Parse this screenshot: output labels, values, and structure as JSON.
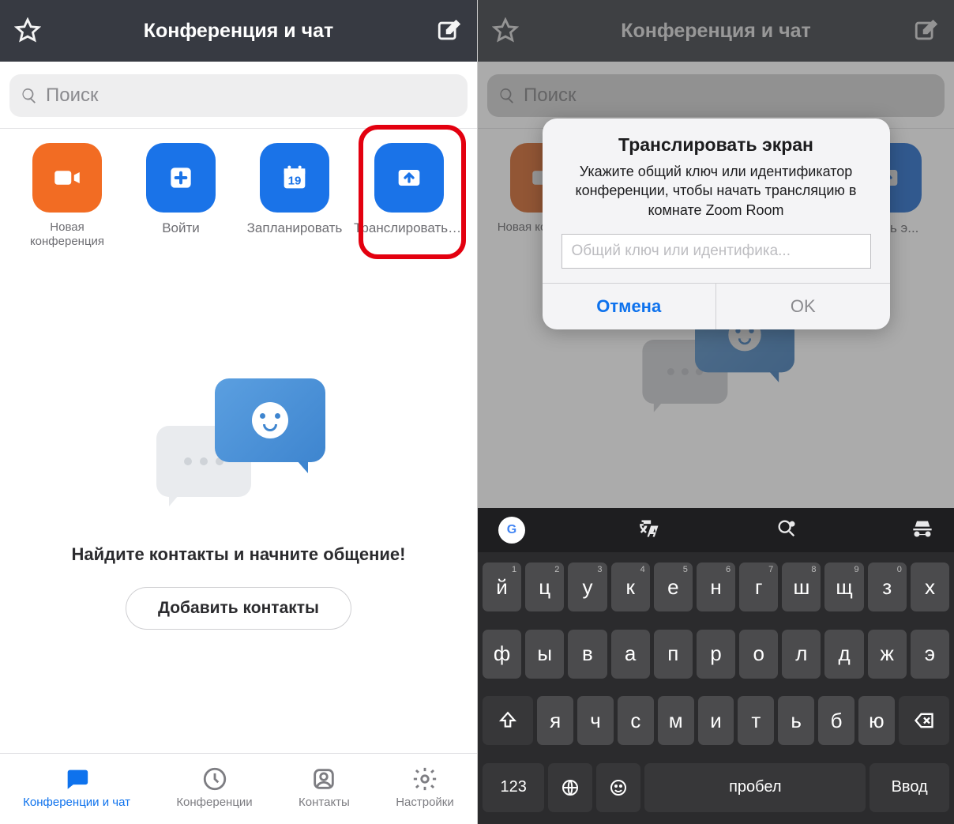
{
  "left": {
    "header": {
      "title": "Конференция и чат"
    },
    "search": {
      "placeholder": "Поиск"
    },
    "actions": [
      {
        "label": "Новая конференция"
      },
      {
        "label": "Войти"
      },
      {
        "label": "Запланировать",
        "day": "19"
      },
      {
        "label": "Транслировать э..."
      }
    ],
    "empty": {
      "text": "Найдите контакты и начните общение!",
      "button": "Добавить контакты"
    },
    "tabs": [
      {
        "label": "Конференции и чат"
      },
      {
        "label": "Конференции"
      },
      {
        "label": "Контакты"
      },
      {
        "label": "Настройки"
      }
    ]
  },
  "right": {
    "header": {
      "title": "Конференция и чат"
    },
    "search": {
      "placeholder": "Поиск"
    },
    "actions": [
      {
        "label": "Новая конфере..."
      },
      {
        "label": ""
      },
      {
        "label": ""
      },
      {
        "label": "ровать э..."
      }
    ],
    "dialog": {
      "title": "Транслировать экран",
      "message": "Укажите общий ключ или идентификатор конференции, чтобы начать трансляцию в комнате Zoom Room",
      "placeholder": "Общий ключ или идентифика...",
      "cancel": "Отмена",
      "ok": "OK"
    },
    "keyboard": {
      "row1": [
        {
          "k": "й",
          "n": "1"
        },
        {
          "k": "ц",
          "n": "2"
        },
        {
          "k": "у",
          "n": "3"
        },
        {
          "k": "к",
          "n": "4"
        },
        {
          "k": "е",
          "n": "5"
        },
        {
          "k": "н",
          "n": "6"
        },
        {
          "k": "г",
          "n": "7"
        },
        {
          "k": "ш",
          "n": "8"
        },
        {
          "k": "щ",
          "n": "9"
        },
        {
          "k": "з",
          "n": "0"
        },
        {
          "k": "х",
          "n": ""
        }
      ],
      "row2": [
        "ф",
        "ы",
        "в",
        "а",
        "п",
        "р",
        "о",
        "л",
        "д",
        "ж",
        "э"
      ],
      "row3": [
        "я",
        "ч",
        "с",
        "м",
        "и",
        "т",
        "ь",
        "б",
        "ю"
      ],
      "bottom": {
        "numkey": "123",
        "space": "пробел",
        "enter": "Ввод"
      }
    }
  }
}
